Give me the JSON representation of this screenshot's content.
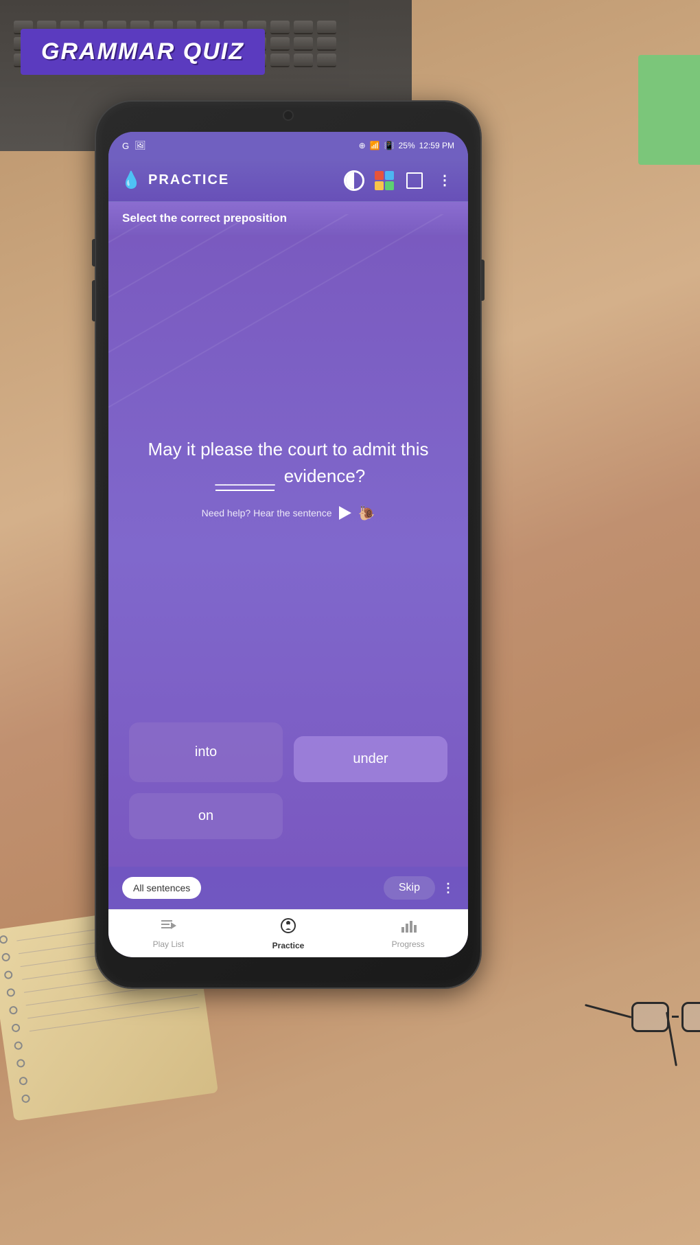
{
  "background": {
    "color": "#c8a87a"
  },
  "banner": {
    "text": "GRAMMAR QUIZ",
    "bg_color": "#5b3bbf"
  },
  "status_bar": {
    "left_icons": [
      "G",
      "🖼"
    ],
    "time_label": "12:59 PM",
    "battery": "25%",
    "wifi": true
  },
  "app_header": {
    "title": "PRACTICE",
    "logo": "💧"
  },
  "question_instruction": {
    "text": "Select the correct preposition"
  },
  "question": {
    "text_before": "May it please the court to admit this",
    "blank": "______",
    "text_after": "evidence?"
  },
  "audio_help": {
    "text": "Need help? Hear the sentence"
  },
  "answers": [
    {
      "label": "into",
      "highlighted": false
    },
    {
      "label": "under",
      "highlighted": true
    },
    {
      "label": "on",
      "highlighted": false
    }
  ],
  "bottom_controls": {
    "all_sentences_label": "All sentences",
    "skip_label": "Skip",
    "more_label": "⋮"
  },
  "bottom_nav": {
    "items": [
      {
        "label": "Play List",
        "icon": "≡♪",
        "active": false
      },
      {
        "label": "Practice",
        "icon": "⚙",
        "active": true
      },
      {
        "label": "Progress",
        "icon": "📊",
        "active": false
      }
    ]
  }
}
